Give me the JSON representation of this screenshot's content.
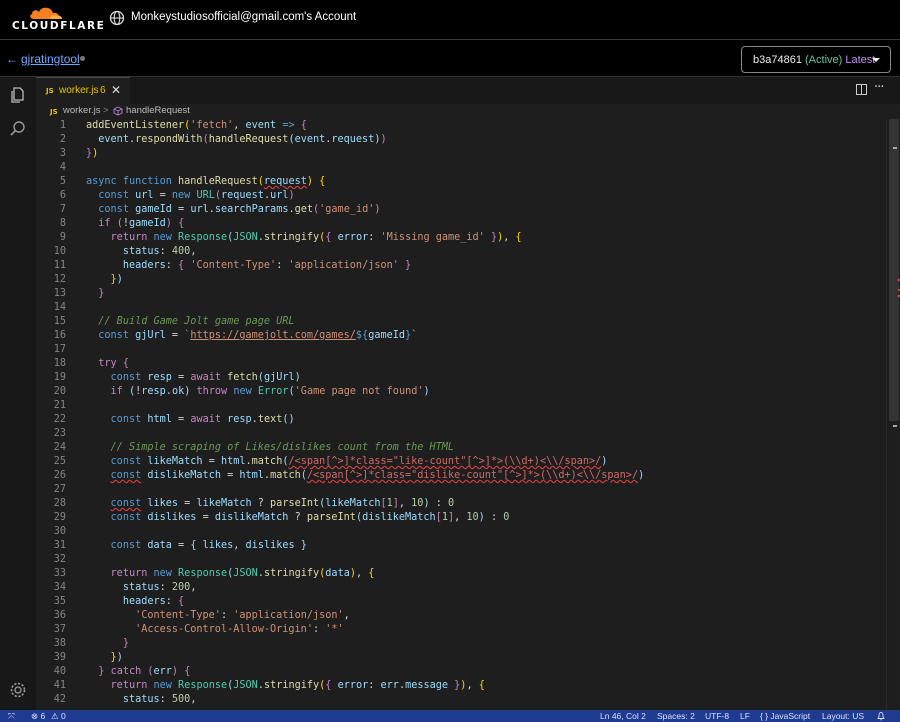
{
  "header": {
    "brand": "CLOUDFLARE",
    "account_label": "Monkeystudiosofficial@gmail.com's Account"
  },
  "subheader": {
    "back_arrow": "←",
    "project_name": "gjratingtool",
    "version_id": "b3a74861",
    "version_status": "(Active)",
    "version_tag": "Latest"
  },
  "tab": {
    "lang_badge": "JS",
    "filename": "worker.js",
    "problem_count": "6",
    "close": "✕"
  },
  "breadcrumb": {
    "lang_badge": "JS",
    "file": "worker.js",
    "separator": ">",
    "symbol_icon": "cube-icon",
    "symbol": "handleRequest"
  },
  "editor": {
    "line_numbers": [
      "1",
      "2",
      "3",
      "4",
      "5",
      "6",
      "7",
      "8",
      "9",
      "10",
      "11",
      "12",
      "13",
      "14",
      "15",
      "16",
      "17",
      "18",
      "19",
      "20",
      "21",
      "22",
      "23",
      "24",
      "25",
      "26",
      "27",
      "28",
      "29",
      "30",
      "31",
      "32",
      "33",
      "34",
      "35",
      "36",
      "37",
      "38",
      "39",
      "40",
      "41",
      "42"
    ],
    "code_lines": [
      "addEventListener('fetch', event => {",
      "  event.respondWith(handleRequest(event.request))",
      "})",
      "",
      "async function handleRequest(request) {",
      "  const url = new URL(request.url)",
      "  const gameId = url.searchParams.get('game_id')",
      "  if (!gameId) {",
      "    return new Response(JSON.stringify({ error: 'Missing game_id' }), {",
      "      status: 400,",
      "      headers: { 'Content-Type': 'application/json' }",
      "    })",
      "  }",
      "",
      "  // Build Game Jolt game page URL",
      "  const gjUrl = `https://gamejolt.com/games/${gameId}`",
      "",
      "  try {",
      "    const resp = await fetch(gjUrl)",
      "    if (!resp.ok) throw new Error('Game page not found')",
      "",
      "    const html = await resp.text()",
      "",
      "    // Simple scraping of Likes/dislikes count from the HTML",
      "    const likeMatch = html.match(/<span[^>]*class=\"like-count\"[^>]*>(\\\\d+)<\\\\/span>/)",
      "    const dislikeMatch = html.match(/<span[^>]*class=\"dislike-count\"[^>]*>(\\\\d+)<\\\\/span>/)",
      "",
      "    const likes = likeMatch ? parseInt(likeMatch[1], 10) : 0",
      "    const dislikes = dislikeMatch ? parseInt(dislikeMatch[1], 10) : 0",
      "",
      "    const data = { likes, dislikes }",
      "",
      "    return new Response(JSON.stringify(data), {",
      "      status: 200,",
      "      headers: {",
      "        'Content-Type': 'application/json',",
      "        'Access-Control-Allow-Origin': '*'",
      "      }",
      "    })",
      "  } catch (err) {",
      "    return new Response(JSON.stringify({ error: err.message }), {",
      "      status: 500,"
    ]
  },
  "statusbar": {
    "remote_icon": "remote-icon",
    "errors": "⊗ 6",
    "warnings": "⚠ 0",
    "position": "Ln 46, Col 2",
    "spaces": "Spaces: 2",
    "encoding": "UTF-8",
    "eol": "LF",
    "language": "{ } JavaScript",
    "layout": "Layout: US",
    "bell_icon": "bell-icon"
  },
  "colors": {
    "accent_blue": "#1f3b8f",
    "link_blue": "#6ea8ff",
    "active_green": "#5cc8a0",
    "latest_purple": "#c78bf0",
    "cloudflare_orange": "#f48120"
  }
}
